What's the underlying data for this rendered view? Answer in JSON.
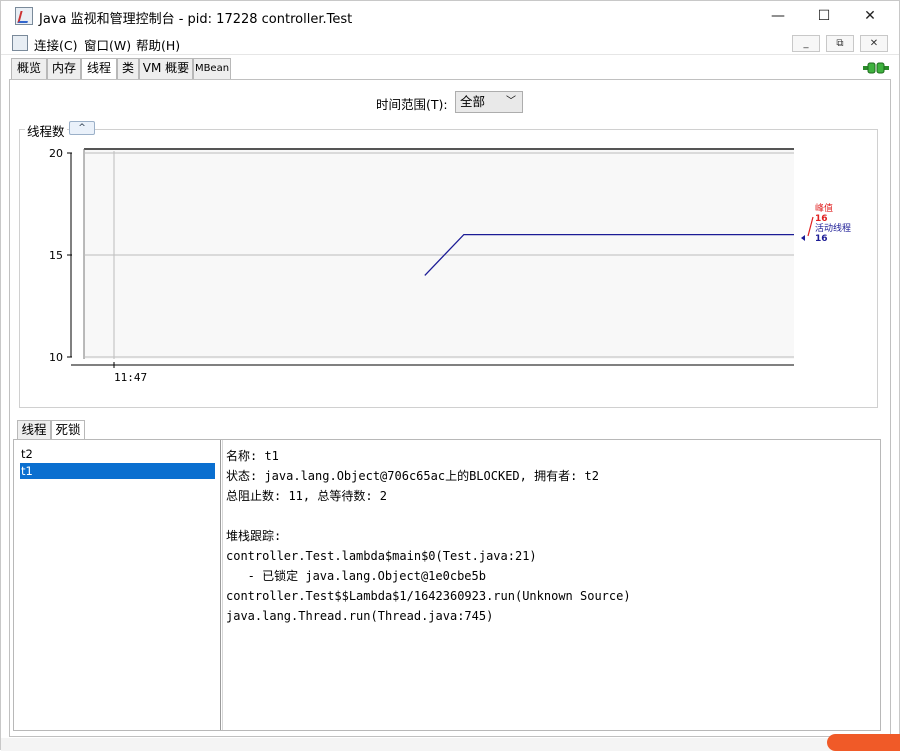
{
  "window": {
    "title": "Java 监视和管理控制台 - pid: 17228 controller.Test",
    "controls": {
      "minimize": "—",
      "maximize": "☐",
      "close": "✕"
    }
  },
  "menu": {
    "items": [
      "连接(C)",
      "窗口(W)",
      "帮助(H)"
    ],
    "mdi": {
      "minimize": "_",
      "restore": "⧉",
      "close": "✕"
    }
  },
  "tabs": [
    "概览",
    "内存",
    "线程",
    "类",
    "VM 概要",
    "MBean"
  ],
  "active_tab": "线程",
  "time_range": {
    "label": "时间范围(T):",
    "selected": "全部"
  },
  "chart": {
    "title": "线程数",
    "collapse_symbol": "^",
    "legend": {
      "peak_label": "峰值",
      "peak_value": "16",
      "live_label": "活动线程",
      "live_value": "16"
    },
    "colors": {
      "peak": "#e02020",
      "live": "#1c1c96"
    }
  },
  "chart_data": {
    "type": "line",
    "title": "线程数",
    "xlabel": "",
    "ylabel": "",
    "x_ticks": [
      "11:47"
    ],
    "y_ticks": [
      10,
      15,
      20
    ],
    "ylim": [
      10,
      20
    ],
    "series": [
      {
        "name": "活动线程",
        "x": [
          0.48,
          0.535,
          1.0
        ],
        "values": [
          14,
          16,
          16
        ]
      }
    ],
    "grid": true
  },
  "lower_tabs": [
    "线程",
    "死锁"
  ],
  "active_lower_tab": "死锁",
  "threads": [
    "t2",
    "t1"
  ],
  "selected_thread": "t1",
  "detail": {
    "lines": [
      "名称: t1",
      "状态: java.lang.Object@706c65ac上的BLOCKED, 拥有者: t2",
      "总阻止数: 11, 总等待数: 2",
      "",
      "堆栈跟踪:",
      "controller.Test.lambda$main$0(Test.java:21)",
      "   - 已锁定 java.lang.Object@1e0cbe5b",
      "controller.Test$$Lambda$1/1642360923.run(Unknown Source)",
      "java.lang.Thread.run(Thread.java:745)"
    ]
  }
}
